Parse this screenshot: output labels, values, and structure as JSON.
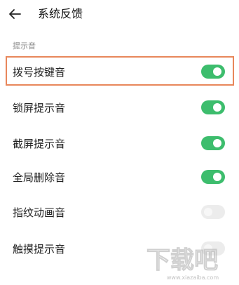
{
  "header": {
    "title": "系统反馈"
  },
  "section": {
    "label": "提示音"
  },
  "settings": [
    {
      "label": "拨号按键音",
      "on": true
    },
    {
      "label": "锁屏提示音",
      "on": true
    },
    {
      "label": "截屏提示音",
      "on": true
    },
    {
      "label": "全局删除音",
      "on": true
    },
    {
      "label": "指纹动画音",
      "on": false
    },
    {
      "label": "触摸提示音",
      "on": false
    }
  ],
  "colors": {
    "toggle_on": "#3dbd6d",
    "toggle_off": "#ececec",
    "highlight": "#e8875b"
  },
  "icons": {
    "back": "back-arrow-icon"
  },
  "watermark": {
    "text": "下载吧",
    "url": "www.xiazaiba.com"
  }
}
